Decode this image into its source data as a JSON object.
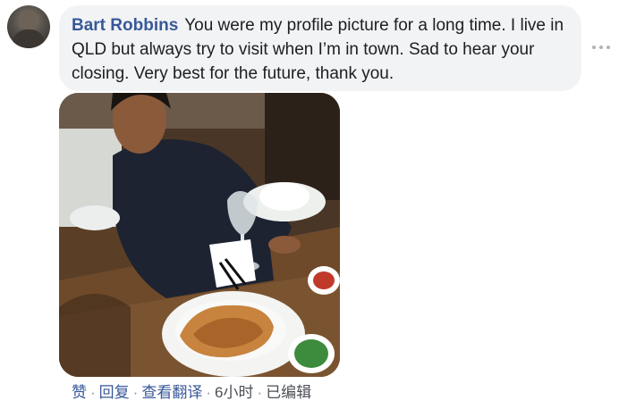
{
  "comment": {
    "author": "Bart Robbins",
    "text": "You were my profile picture for a long time. I live in QLD but always try to visit when I’m in town. Sad to hear your closing. Very best for the future, thank you."
  },
  "actions": {
    "like": "赞",
    "reply": "回复",
    "translate": "查看翻译",
    "time": "6小时",
    "edited": "已编辑",
    "separator": "·"
  },
  "icons": {
    "more": "more-horizontal-icon"
  }
}
